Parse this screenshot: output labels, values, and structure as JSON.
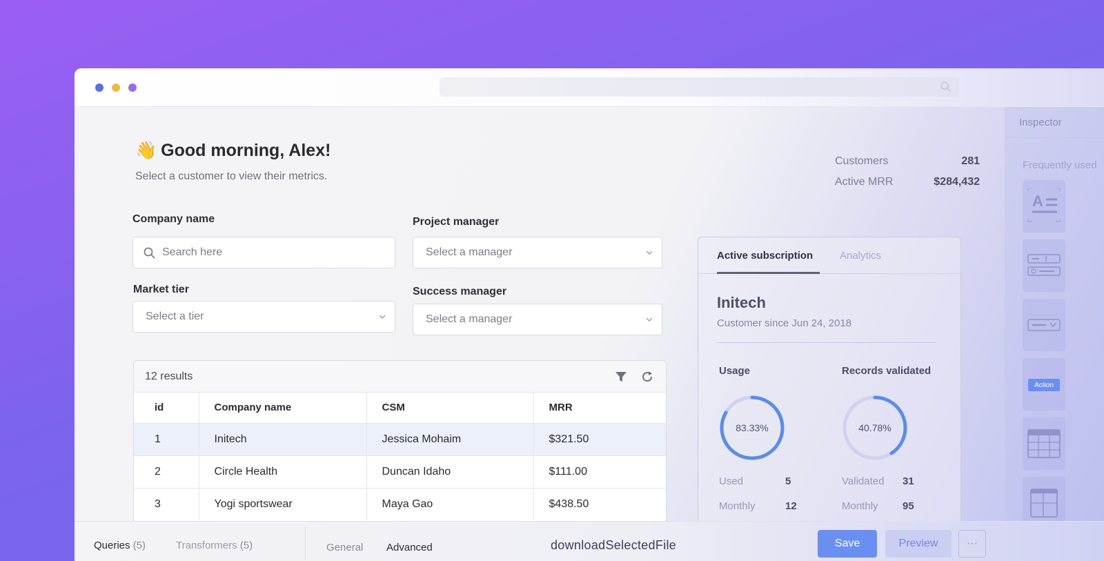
{
  "greeting": {
    "emoji": "👋",
    "title": "Good morning, Alex!",
    "subtitle": "Select a customer to view their metrics."
  },
  "stats": [
    {
      "label": "Customers",
      "value": "281"
    },
    {
      "label": "Active MRR",
      "value": "$284,432"
    }
  ],
  "filters": {
    "company": {
      "label": "Company name",
      "placeholder": "Search here"
    },
    "project_manager": {
      "label": "Project manager",
      "placeholder": "Select a manager"
    },
    "market_tier": {
      "label": "Market tier",
      "placeholder": "Select a tier"
    },
    "success_manager": {
      "label": "Success manager",
      "placeholder": "Select a manager"
    }
  },
  "table": {
    "results": "12 results",
    "columns": [
      "id",
      "Company name",
      "CSM",
      "MRR"
    ],
    "rows": [
      [
        "1",
        "Initech",
        "Jessica Mohaim",
        "$321.50"
      ],
      [
        "2",
        "Circle Health",
        "Duncan Idaho",
        "$111.00"
      ],
      [
        "3",
        "Yogi sportswear",
        "Maya Gao",
        "$438.50"
      ]
    ]
  },
  "detail": {
    "tabs": [
      "Active subscription",
      "Analytics"
    ],
    "name": "Initech",
    "since": "Customer since Jun 24, 2018",
    "usage": {
      "title": "Usage",
      "percent_label": "83.33%",
      "percent": 83.33,
      "rows": [
        [
          "Used",
          "5"
        ],
        [
          "Monthly",
          "12"
        ]
      ]
    },
    "records": {
      "title": "Records validated",
      "percent_label": "40.78%",
      "percent": 40.78,
      "rows": [
        [
          "Validated",
          "31"
        ],
        [
          "Monthly",
          "95"
        ]
      ]
    }
  },
  "inspector": {
    "title": "Inspector",
    "section": "Frequently used",
    "action_label": "Action"
  },
  "bottom": {
    "queries": "Queries",
    "queries_count": "(5)",
    "transformers": "Transformers",
    "transformers_count": "(5)",
    "tab_general": "General",
    "tab_advanced": "Advanced",
    "function_name": "downloadSelectedFile",
    "save": "Save",
    "preview": "Preview",
    "more": "···"
  },
  "colors": {
    "accent": "#6b8ff0",
    "ring": "#5b8ce8",
    "background_from": "#9b5ff2",
    "background_to": "#6a6ff0"
  }
}
